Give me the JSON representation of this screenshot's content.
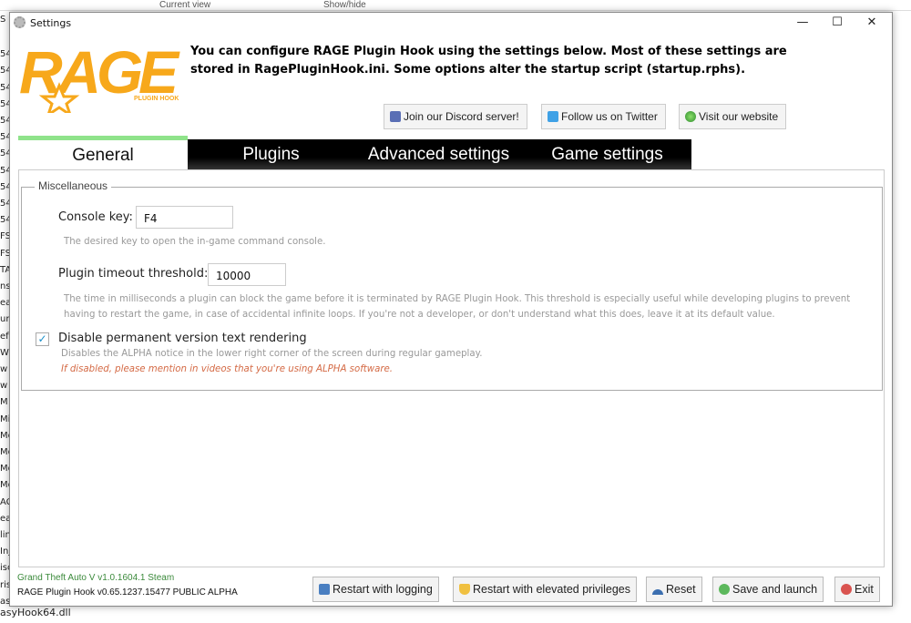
{
  "background": {
    "top_labels": [
      "Current view",
      "Show/hide"
    ],
    "left_fragments": [
      "S",
      "54",
      "54",
      "54",
      "54",
      "54",
      "54",
      "54",
      "54",
      "54",
      "54",
      "54",
      "FS",
      "FS",
      "TA",
      "nst",
      "ea",
      "ur",
      "ef",
      "W",
      "w",
      "w",
      "M",
      "Mic",
      "Mo",
      "Mo",
      "Mo",
      "Mo",
      "AC",
      "ea",
      "lin",
      "Inj",
      "isc",
      "ris",
      "as"
    ],
    "bottom_file": "asyHook64.dll"
  },
  "window": {
    "title": "Settings",
    "controls": {
      "minimize": "—",
      "maximize": "☐",
      "close": "✕"
    }
  },
  "logo": {
    "text": "RAGE",
    "subtext": "PLUGIN HOOK"
  },
  "intro": "You can configure RAGE Plugin Hook using the settings below. Most of these settings are stored in RagePluginHook.ini. Some options alter the startup script (startup.rphs).",
  "links": [
    {
      "label": "Join our Discord server!",
      "icon": "discord-icon",
      "color": "#5a6fb5"
    },
    {
      "label": "Follow us on Twitter",
      "icon": "twitter-icon",
      "color": "#3fa1e6"
    },
    {
      "label": "Visit our website",
      "icon": "globe-icon",
      "color": "#4caf50"
    }
  ],
  "tabs": [
    {
      "label": "General",
      "active": true
    },
    {
      "label": "Plugins"
    },
    {
      "label": "Advanced settings"
    },
    {
      "label": "Game settings"
    }
  ],
  "accent": "#8fe38a",
  "general": {
    "group_title": "Miscellaneous",
    "console_key": {
      "label": "Console key:",
      "value": "F4",
      "description": "The desired key to open the in-game command console."
    },
    "plugin_timeout": {
      "label": "Plugin timeout threshold:",
      "value": "10000",
      "description": "The time in milliseconds a plugin can block the game before it is terminated by RAGE Plugin Hook. This threshold is especially useful while developing plugins to prevent having to restart the game, in case of accidental infinite loops. If you're not a developer, or don't understand what this does, leave it at its default value."
    },
    "disable_version_text": {
      "label": "Disable permanent version text rendering",
      "checked": true,
      "description": "Disables the ALPHA notice in the lower right corner of the screen during regular gameplay.",
      "warning": "If disabled, please mention in videos that you're using ALPHA software."
    }
  },
  "status": {
    "game": "Grand Theft Auto V v1.0.1604.1 Steam",
    "version": "RAGE Plugin Hook v0.65.1237.15477 PUBLIC ALPHA"
  },
  "buttons": {
    "restart_logging": "Restart with logging",
    "restart_elevated": "Restart with elevated privileges",
    "reset": "Reset",
    "save_launch": "Save and launch",
    "exit": "Exit"
  }
}
